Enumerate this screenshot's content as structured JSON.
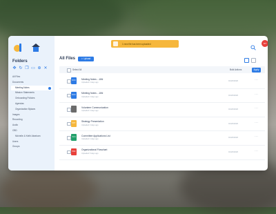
{
  "colors": {
    "accent": "#2d7be5",
    "notice": "#f6b73c",
    "avatar": "#e8403b"
  },
  "notice": {
    "text": "1 new file has been uploaded"
  },
  "sidebar": {
    "title": "Folders",
    "items": [
      {
        "label": "All Files",
        "active": false,
        "indent": false
      },
      {
        "label": "Documents",
        "active": false,
        "indent": false
      },
      {
        "label": "Meeting Notes",
        "active": true,
        "indent": true
      },
      {
        "label": "Mission Statements",
        "active": false,
        "indent": true
      },
      {
        "label": "Onboarding Policies",
        "active": false,
        "indent": true
      },
      {
        "label": "Agendas",
        "active": false,
        "indent": true
      },
      {
        "label": "Organization Bylaws",
        "active": false,
        "indent": true
      },
      {
        "label": "Images",
        "active": false,
        "indent": false
      },
      {
        "label": "Recording",
        "active": false,
        "indent": false
      },
      {
        "label": "Audio",
        "active": false,
        "indent": false
      },
      {
        "label": "CBD",
        "active": false,
        "indent": false
      },
      {
        "label": "Michelle & Keith Abraham",
        "active": false,
        "indent": true
      },
      {
        "label": "Users",
        "active": false,
        "indent": false
      },
      {
        "label": "Groups",
        "active": false,
        "indent": false
      }
    ]
  },
  "main": {
    "title": "All Files",
    "upload_label": "Upload",
    "select_all_label": "Select All",
    "bulk_actions_label": "Bulk Actions",
    "apply_label": "Apply",
    "avatar_initials": "MT"
  },
  "files": [
    {
      "name": "Meeting Notes - JAN",
      "sub": "Uploaded 2 days ago",
      "date": "01/20/2020",
      "thumb_color": "#2d7be5",
      "thumb_label": "DOC"
    },
    {
      "name": "Meeting Notes - JAN",
      "sub": "Uploaded 2 days ago",
      "date": "01/20/2020",
      "thumb_color": "#2d7be5",
      "thumb_label": "DOC"
    },
    {
      "name": "Volunteer Communication",
      "sub": "Uploaded 3 days ago",
      "date": "01/20/2020",
      "thumb_color": "#6b6b6b",
      "thumb_label": ""
    },
    {
      "name": "Strategy Presentation",
      "sub": "Uploaded 3 days ago",
      "date": "01/20/2020",
      "thumb_color": "#f6b73c",
      "thumb_label": "PPT"
    },
    {
      "name": "Committee Applications List",
      "sub": "Uploaded 4 days ago",
      "date": "01/20/2020",
      "thumb_color": "#22a06b",
      "thumb_label": "XLS"
    },
    {
      "name": "Organizational Flowchart",
      "sub": "Uploaded 5 days ago",
      "date": "01/20/2020",
      "thumb_color": "#e8403b",
      "thumb_label": "PDF"
    }
  ]
}
